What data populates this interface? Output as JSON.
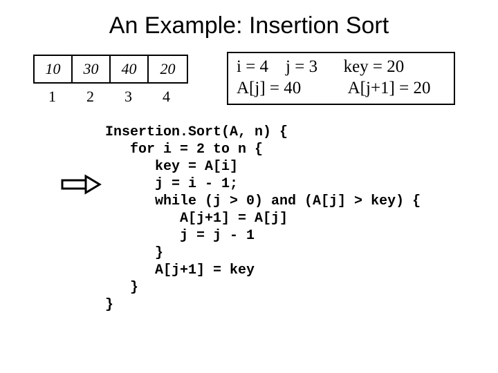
{
  "title": "An Example: Insertion Sort",
  "array": {
    "cells": [
      "10",
      "30",
      "40",
      "20"
    ],
    "indices": [
      "1",
      "2",
      "3",
      "4"
    ]
  },
  "status": {
    "line1": "i = 4    j = 3      key = 20",
    "line2": "A[j] = 40           A[j+1] = 20"
  },
  "code": "Insertion.Sort(A, n) {\n   for i = 2 to n {\n      key = A[i]\n      j = i - 1;\n      while (j > 0) and (A[j] > key) {\n         A[j+1] = A[j]\n         j = j - 1\n      }\n      A[j+1] = key\n   }\n}"
}
